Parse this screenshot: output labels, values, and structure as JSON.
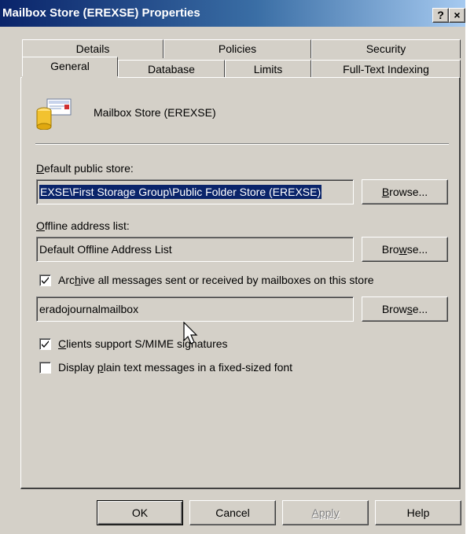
{
  "window": {
    "title": "Mailbox Store (EREXSE) Properties",
    "help_button": "?",
    "close_button": "×"
  },
  "tabs": {
    "row1": [
      {
        "label": "Details"
      },
      {
        "label": "Policies"
      },
      {
        "label": "Security"
      }
    ],
    "row2": [
      {
        "label": "General",
        "active": true
      },
      {
        "label": "Database"
      },
      {
        "label": "Limits"
      },
      {
        "label": "Full-Text Indexing"
      }
    ]
  },
  "general": {
    "store_name": "Mailbox Store (EREXSE)",
    "default_public_store": {
      "label_pre": "",
      "label_key": "D",
      "label_post": "efault public store:",
      "value": "EXSE\\First Storage Group\\Public Folder Store (EREXSE)",
      "browse": {
        "pre": "",
        "key": "B",
        "post": "rowse..."
      }
    },
    "offline_address_list": {
      "label_pre": "",
      "label_key": "O",
      "label_post": "ffline address list:",
      "value": "Default Offline Address List",
      "browse": {
        "pre": "Bro",
        "key": "w",
        "post": "se..."
      }
    },
    "archive": {
      "checked": true,
      "label_pre": "Arc",
      "label_key": "h",
      "label_post": "ive all messages sent or received by mailboxes on this store",
      "value": "eradojournalmailbox",
      "browse": {
        "pre": "Brow",
        "key": "s",
        "post": "e..."
      }
    },
    "smime": {
      "checked": true,
      "label_pre": "",
      "label_key": "C",
      "label_post": "lients support S/MIME signatures"
    },
    "plain_text": {
      "checked": false,
      "label_pre": "Display ",
      "label_key": "p",
      "label_post": "lain text messages in a fixed-sized font"
    }
  },
  "footer": {
    "ok": "OK",
    "cancel": "Cancel",
    "apply": "Apply",
    "help": "Help"
  }
}
